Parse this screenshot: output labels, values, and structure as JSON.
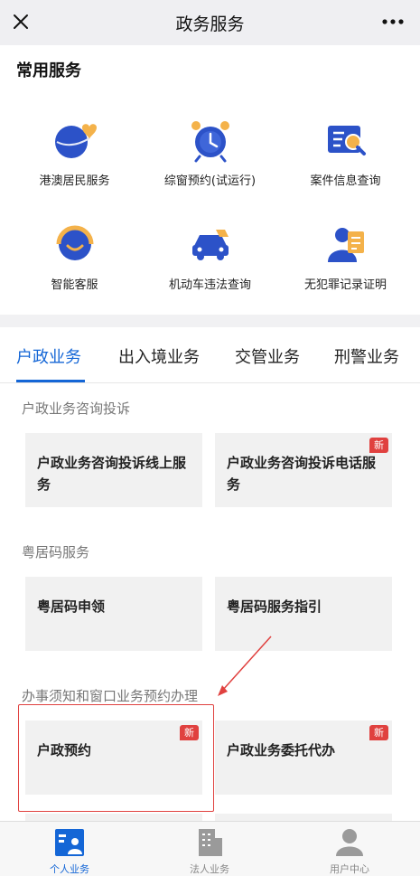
{
  "header": {
    "title": "政务服务",
    "close_icon": "close-icon",
    "more_icon": "more-icon"
  },
  "common": {
    "title": "常用服务",
    "items": [
      {
        "label": "港澳居民服务",
        "icon": "hk-macau-resident-icon"
      },
      {
        "label": "综窗预约(试运行)",
        "icon": "alarm-clock-icon"
      },
      {
        "label": "案件信息查询",
        "icon": "case-search-icon"
      },
      {
        "label": "智能客服",
        "icon": "customer-service-icon"
      },
      {
        "label": "机动车违法查询",
        "icon": "vehicle-violation-icon"
      },
      {
        "label": "无犯罪记录证明",
        "icon": "no-criminal-record-icon"
      }
    ]
  },
  "tabs": [
    {
      "label": "户政业务",
      "active": true
    },
    {
      "label": "出入境业务",
      "active": false
    },
    {
      "label": "交管业务",
      "active": false
    },
    {
      "label": "刑警业务",
      "active": false
    }
  ],
  "sections": [
    {
      "title": "户政业务咨询投诉",
      "cards": [
        {
          "label": "户政业务咨询投诉线上服务",
          "badge": ""
        },
        {
          "label": "户政业务咨询投诉电话服务",
          "badge": "新"
        }
      ]
    },
    {
      "title": "粤居码服务",
      "cards": [
        {
          "label": "粤居码申领",
          "badge": ""
        },
        {
          "label": "粤居码服务指引",
          "badge": ""
        }
      ]
    },
    {
      "title": "办事须知和窗口业务预约办理",
      "cards": [
        {
          "label": "户政预约",
          "badge": "新"
        },
        {
          "label": "户政业务委托代办",
          "badge": "新"
        }
      ]
    }
  ],
  "bottom_nav": [
    {
      "label": "个人业务",
      "icon": "personal-icon",
      "active": true
    },
    {
      "label": "法人业务",
      "icon": "building-icon",
      "active": false
    },
    {
      "label": "用户中心",
      "icon": "user-icon",
      "active": false
    }
  ],
  "colors": {
    "accent": "#1466d6",
    "badge": "#e0413f",
    "highlight": "#e0413f"
  }
}
